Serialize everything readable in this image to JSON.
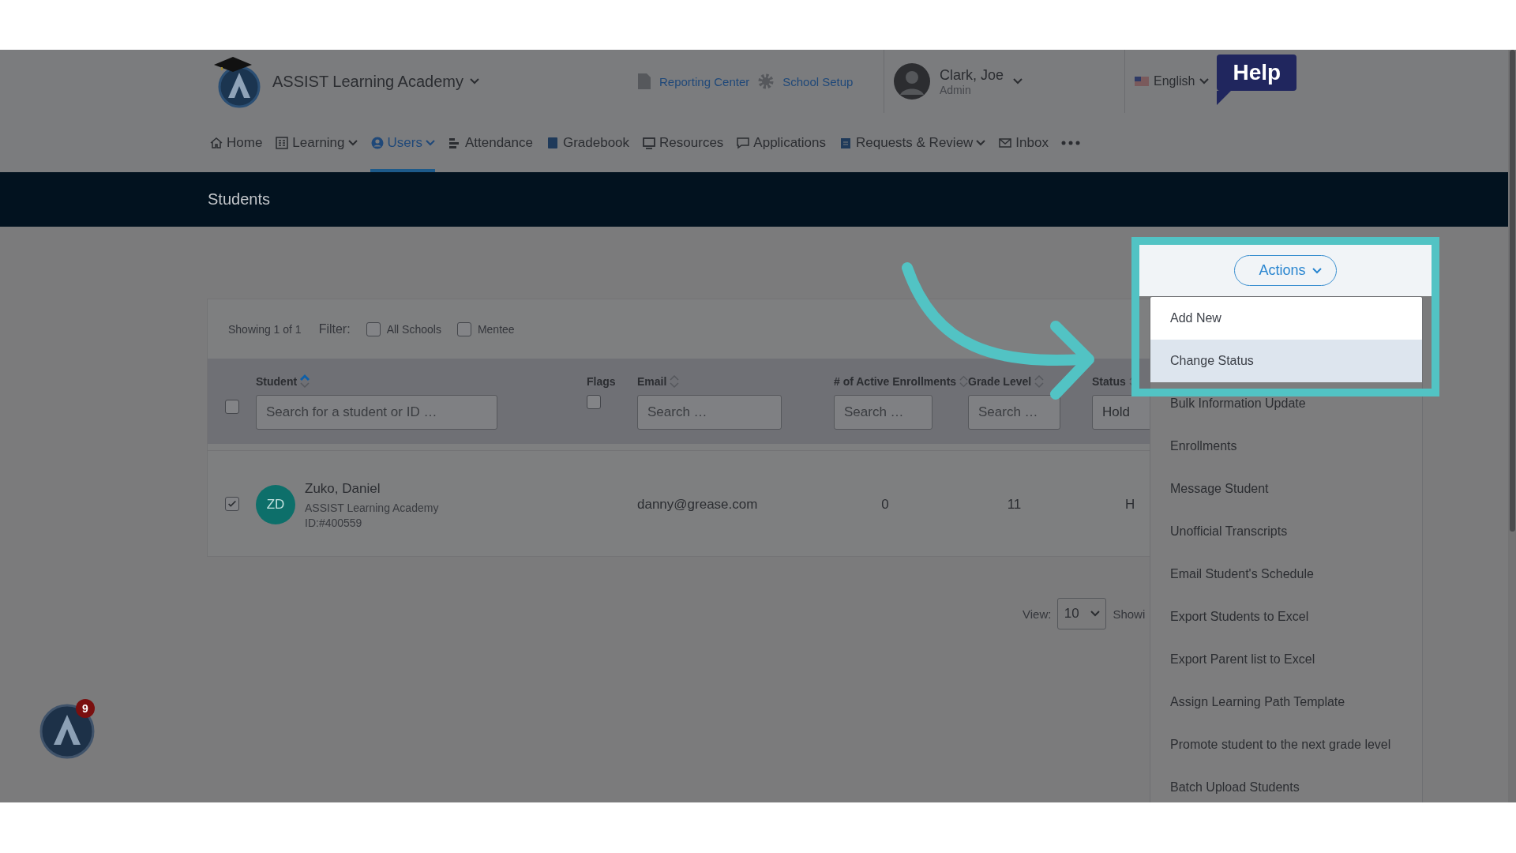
{
  "header": {
    "school_name": "ASSIST Learning Academy",
    "links": [
      "Reporting Center",
      "School Setup"
    ],
    "user": {
      "name": "Clark, Joe",
      "role": "Admin"
    },
    "language": "English",
    "help": "Help"
  },
  "nav": [
    {
      "label": "Home",
      "selected": false,
      "dropdown": false
    },
    {
      "label": "Learning",
      "selected": false,
      "dropdown": true
    },
    {
      "label": "Users",
      "selected": true,
      "dropdown": true
    },
    {
      "label": "Attendance",
      "selected": false,
      "dropdown": false
    },
    {
      "label": "Gradebook",
      "selected": false,
      "dropdown": false
    },
    {
      "label": "Resources",
      "selected": false,
      "dropdown": false
    },
    {
      "label": "Applications",
      "selected": false,
      "dropdown": false
    },
    {
      "label": "Requests & Review",
      "selected": false,
      "dropdown": true
    },
    {
      "label": "Inbox",
      "selected": false,
      "dropdown": false
    }
  ],
  "page_title": "Students",
  "filter": {
    "showing": "Showing 1 of 1",
    "label": "Filter:",
    "options": [
      {
        "label": "All Schools",
        "checked": false
      },
      {
        "label": "Mentee",
        "checked": false
      }
    ]
  },
  "table": {
    "select_all_checked": false,
    "columns": [
      {
        "label": "Student",
        "sortable": true,
        "sorted": true,
        "filter": {
          "kind": "search",
          "placeholder": "Search for a student or ID …"
        }
      },
      {
        "label": "Flags",
        "sortable": false,
        "filter": {
          "kind": "checkbox",
          "checked": false
        }
      },
      {
        "label": "Email",
        "sortable": true,
        "sorted": false,
        "filter": {
          "kind": "search",
          "placeholder": "Search …"
        }
      },
      {
        "label": "# of Active Enrollments",
        "sortable": true,
        "sorted": false,
        "filter": {
          "kind": "search",
          "placeholder": "Search …"
        }
      },
      {
        "label": "Grade Level",
        "sortable": true,
        "sorted": false,
        "filter": {
          "kind": "search",
          "placeholder": "Search …"
        }
      },
      {
        "label": "Status",
        "sortable": true,
        "sorted": false,
        "filter": {
          "kind": "select",
          "value": "Hold"
        }
      }
    ],
    "rows": [
      {
        "checked": true,
        "initials": "ZD",
        "name": "Zuko, Daniel",
        "school": "ASSIST Learning Academy",
        "id": "ID:#400559",
        "email": "danny@grease.com",
        "enrollments": "0",
        "grade": "11",
        "status": "H"
      }
    ]
  },
  "pagination": {
    "view_label": "View:",
    "view_value": "10",
    "showing": "Showi"
  },
  "actions": {
    "label": "Actions",
    "items": [
      {
        "label": "Add New",
        "selected": false,
        "spotlighted": true
      },
      {
        "label": "Change Status",
        "selected": true,
        "spotlighted": true
      },
      {
        "label": "Bulk Information Update",
        "selected": false,
        "spotlighted": false
      },
      {
        "label": "Enrollments",
        "selected": false,
        "spotlighted": false
      },
      {
        "label": "Message Student",
        "selected": false,
        "spotlighted": false
      },
      {
        "label": "Unofficial Transcripts",
        "selected": false,
        "spotlighted": false
      },
      {
        "label": "Email Student's Schedule",
        "selected": false,
        "spotlighted": false
      },
      {
        "label": "Export Students to Excel",
        "selected": false,
        "spotlighted": false
      },
      {
        "label": "Export Parent list to Excel",
        "selected": false,
        "spotlighted": false
      },
      {
        "label": "Assign Learning Path Template",
        "selected": false,
        "spotlighted": false
      },
      {
        "label": "Promote student to the next grade level",
        "selected": false,
        "spotlighted": false
      },
      {
        "label": "Batch Upload Students",
        "selected": false,
        "spotlighted": false
      }
    ]
  },
  "chat_badge": {
    "count": "9"
  }
}
